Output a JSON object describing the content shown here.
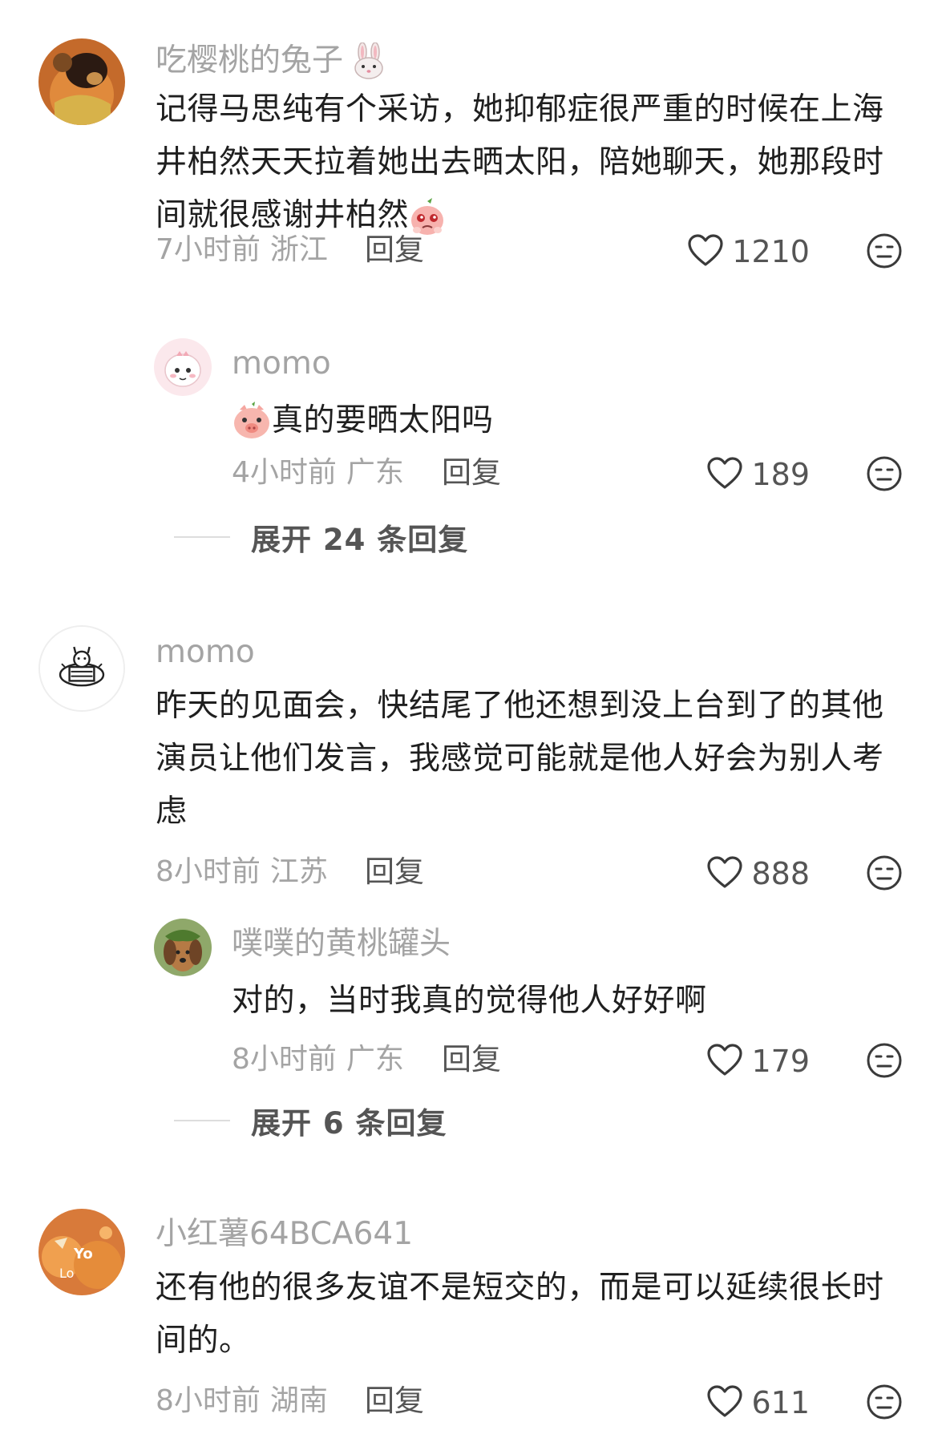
{
  "comments": [
    {
      "username": "吃樱桃的兔子",
      "username_emoji": "rabbit-face-icon",
      "content": "记得马思纯有个采访，她抑郁症很严重的时候在上海井柏然天天拉着她出去晒太阳，陪她聊天，她那段时间就很感谢井柏然",
      "content_emoji": "moved-face-emoji",
      "time": "7小时前",
      "location": "浙江",
      "reply_label": "回复",
      "likes": "1210",
      "replies": [
        {
          "username": "momo",
          "content_emoji": "pig-face-emoji",
          "content": "真的要晒太阳吗",
          "time": "4小时前",
          "location": "广东",
          "reply_label": "回复",
          "likes": "189"
        }
      ],
      "expand_label": "展开 24 条回复"
    },
    {
      "username": "momo",
      "content": "昨天的见面会，快结尾了他还想到没上台到了的其他演员让他们发言，我感觉可能就是他人好会为别人考虑",
      "time": "8小时前",
      "location": "江苏",
      "reply_label": "回复",
      "likes": "888",
      "replies": [
        {
          "username": "噗噗的黄桃罐头",
          "content": "对的，当时我真的觉得他人好好啊",
          "time": "8小时前",
          "location": "广东",
          "reply_label": "回复",
          "likes": "179"
        }
      ],
      "expand_label": "展开 6 条回复"
    },
    {
      "username": "小红薯64BCA641",
      "content": "还有他的很多友谊不是短交的，而是可以延续很长时间的。",
      "time": "8小时前",
      "location": "湖南",
      "reply_label": "回复",
      "likes": "611"
    }
  ],
  "icons": {
    "like": "heart-outline-icon",
    "dislike": "neutral-face-icon"
  },
  "colors": {
    "text_primary": "#1f1f1f",
    "text_secondary": "#a4a4a4",
    "text_action": "#555555",
    "background": "#ffffff"
  }
}
